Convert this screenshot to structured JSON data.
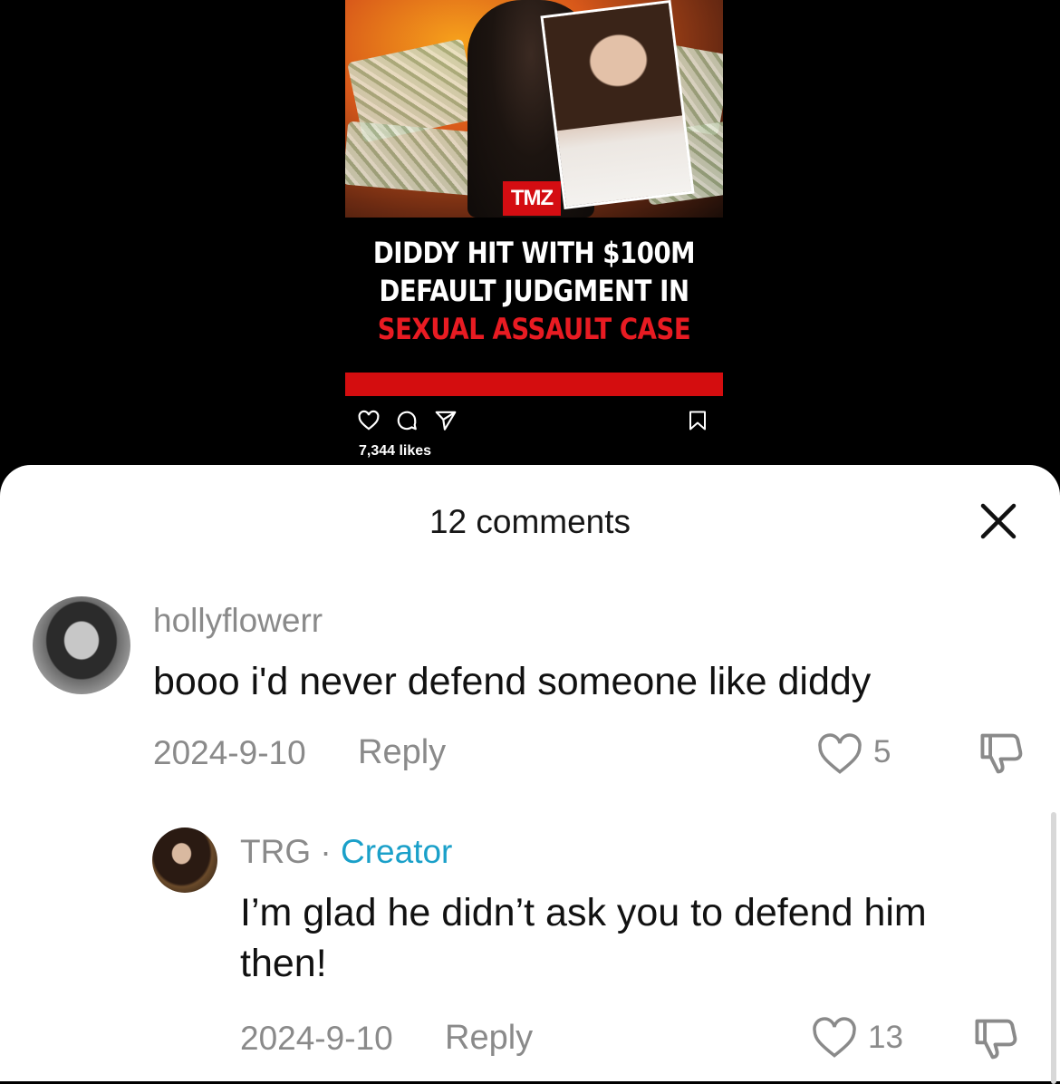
{
  "post": {
    "headline_line1": "DIDDY HIT WITH $100M",
    "headline_line2": "DEFAULT JUDGMENT IN",
    "headline_line3": "SEXUAL ASSAULT CASE",
    "logo_text": "TMZ",
    "likes": "7,344 likes",
    "colors": {
      "accent_red": "#d40d0f",
      "headline_red": "#e81b22"
    }
  },
  "sheet": {
    "title": "12 comments",
    "close_icon": "close-icon"
  },
  "comments": [
    {
      "username": "hollyflowerr",
      "text": "booo i'd never defend someone like diddy",
      "date": "2024-9-10",
      "reply_label": "Reply",
      "likes": "5"
    },
    {
      "username": "TRG",
      "separator": " · ",
      "badge": "Creator",
      "text_line1": "I’m glad he didn’t ask you to defend him",
      "text_line2": "then!",
      "date": "2024-9-10",
      "reply_label": "Reply",
      "likes": "13"
    }
  ],
  "colors": {
    "creator_badge": "#1aa0c9",
    "muted": "#8a8a8a"
  }
}
